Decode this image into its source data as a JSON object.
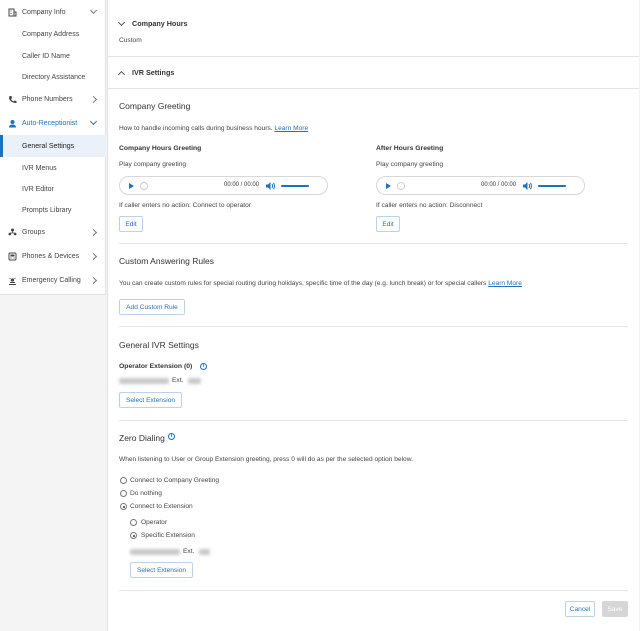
{
  "sidebar": {
    "items": [
      {
        "label": "Company Info",
        "icon": "building-icon"
      },
      {
        "label": "Company Address"
      },
      {
        "label": "Caller ID Name"
      },
      {
        "label": "Directory Assistance"
      },
      {
        "label": "Phone Numbers",
        "icon": "phone-icon"
      },
      {
        "label": "Auto-Receptionist",
        "icon": "user-icon"
      },
      {
        "label": "General Settings"
      },
      {
        "label": "IVR Menus"
      },
      {
        "label": "IVR Editor"
      },
      {
        "label": "Prompts Library"
      },
      {
        "label": "Groups",
        "icon": "group-icon"
      },
      {
        "label": "Phones & Devices",
        "icon": "phone-device-icon"
      },
      {
        "label": "Emergency Calling",
        "icon": "emergency-icon"
      }
    ]
  },
  "company_hours": {
    "title": "Company Hours",
    "value": "Custom"
  },
  "ivr": {
    "title": "IVR Settings",
    "greeting": {
      "title": "Company Greeting",
      "description": "How to handle incoming calls during business hours.",
      "learn_more": "Learn More",
      "company_hours": {
        "title": "Company Hours Greeting",
        "play_label": "Play company greeting",
        "time": "00:00 / 00:00",
        "no_action": "If caller enters no action: Connect to operator",
        "edit": "Edit"
      },
      "after_hours": {
        "title": "After Hours Greeting",
        "play_label": "Play company greeting",
        "time": "00:00 / 00:00",
        "no_action": "If caller enters no action: Disconnect",
        "edit": "Edit"
      }
    },
    "custom_rules": {
      "title": "Custom Answering Rules",
      "description": "You can create custom rules for special routing during holidays, specific time of the day (e.g. lunch break) or for special callers",
      "learn_more": "Learn More",
      "add_button": "Add Custom Rule"
    },
    "general": {
      "title": "General IVR Settings",
      "operator_label": "Operator Extension (0)",
      "ext_label": "Ext.",
      "select_button": "Select Extension"
    },
    "zero_dialing": {
      "title": "Zero Dialing",
      "description": "When listening to User or Group Extension greeting, press 0 will do as per the selected option below.",
      "options": [
        "Connect to Company Greeting",
        "Do nothing",
        "Connect to Extension"
      ],
      "sub_options": [
        "Operator",
        "Specific Extension"
      ],
      "ext_label": "Ext.",
      "select_button": "Select Extension"
    }
  },
  "footer": {
    "cancel": "Cancel",
    "save": "Save"
  },
  "colors": {
    "accent": "#1e72bb",
    "active_bg": "#eaf1f8"
  }
}
